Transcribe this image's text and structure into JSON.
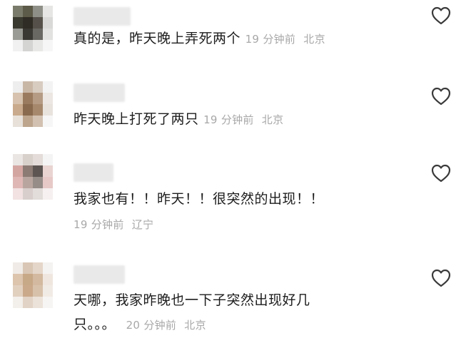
{
  "comments": [
    {
      "text": "真的是，昨天晚上弄死两个",
      "time": "19 分钟前",
      "location": "北京",
      "avatar_pixels": [
        "#7a7b6b",
        "#5c5a48",
        "#8e8f86",
        "#e6e6e4",
        "#3b3a30",
        "#2e2c24",
        "#55514a",
        "#d9d9d7",
        "#9b9b95",
        "#3a3833",
        "#6a6862",
        "#e2e2e0",
        "#f1f1f1",
        "#d4d4d2",
        "#e8e8e6",
        "#f6f6f6"
      ]
    },
    {
      "text": "昨天晚上打死了两只",
      "time": "19 分钟前",
      "location": "北京",
      "avatar_pixels": [
        "#eeeeee",
        "#c9b7a6",
        "#d8ccc0",
        "#f3f3f3",
        "#d6c2ae",
        "#9b7b5f",
        "#b59b84",
        "#ece7e2",
        "#c9aa8c",
        "#8a6a4f",
        "#a6896d",
        "#e9e3dd",
        "#e7e1da",
        "#bda58d",
        "#d2c1b0",
        "#f6f6f6"
      ]
    },
    {
      "text": "我家也有！！昨天！！很突然的出现！！",
      "time": "19 分钟前",
      "location": "辽宁",
      "avatar_pixels": [
        "#eae6e4",
        "#d8d0cb",
        "#e3dcd8",
        "#f4f4f4",
        "#d4a6a2",
        "#8c7a74",
        "#5c5552",
        "#e9d4d2",
        "#dfb8b6",
        "#b9a5a0",
        "#968c88",
        "#e7c9c8",
        "#f2e2e2",
        "#d8cfcc",
        "#e2dcda",
        "#f6f0f0"
      ]
    },
    {
      "text_line1": "天哪，我家昨晚也一下子突然出现好几",
      "text_line2": "只。。。",
      "time": "20 分钟前",
      "location": "北京",
      "avatar_pixels": [
        "#f0ebe6",
        "#d9c6b4",
        "#e4d6c9",
        "#f5f3f1",
        "#dcc4ad",
        "#c7a887",
        "#d3b99f",
        "#efe7df",
        "#e2d0bf",
        "#caa98a",
        "#d8c1ab",
        "#f1ebe5",
        "#f3efeb",
        "#e1d3c5",
        "#ebe2d9",
        "#f7f5f3"
      ]
    }
  ]
}
